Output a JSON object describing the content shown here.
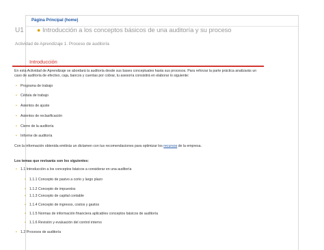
{
  "header": {
    "home_link": "Página Principal (home)"
  },
  "unit": {
    "code": "U1",
    "title": "Introducción a los conceptos básicos de una auditoría y su proceso"
  },
  "activity": "Actividad de Aprendizaje 1. Proceso de auditoría",
  "section": {
    "title": "Introducción",
    "intro": "En esta Actividad de Aprendizaje se abordará la auditoría desde sus bases conceptuales hasta sus procesos. Para reforzar la parte práctica analizarás un caso de auditoría de efectivo, caja, bancos y cuentas por cobrar, tu asesoría consistirá en elaborar lo siguiente:",
    "deliverables": [
      "Programa de trabajo",
      "Cédula de trabajo",
      "Asientos de ajuste",
      "Asientos de reclasificación",
      "Cierre de la auditoría",
      "Informe de auditoría"
    ],
    "closing_before": "Con la información obtenida emitirás un dictamen con tus recomendaciones para optimizar los",
    "closing_link": "recursos",
    "closing_after": "de la empresa.",
    "topics_heading": "Los temas que revisarás son los siguientes:",
    "topics": [
      {
        "label": "1.1 Introducción a los conceptos básicos a considerar en una auditoría",
        "children": [
          "1.1.1 Concepto de pasivo a corto y largo plazo",
          "1.1.2 Concepto de impuestos",
          "1.1.3 Concepto de capital contable",
          "1.1.4 Concepto de ingresos, costos y gastos",
          "1.1.5 Normas de información financiera aplicables conceptos básicos de auditoría",
          "1.1.6 Revisión y evaluación del control interno"
        ]
      },
      {
        "label": "1.2 Procesos de auditoría",
        "children": []
      }
    ]
  }
}
